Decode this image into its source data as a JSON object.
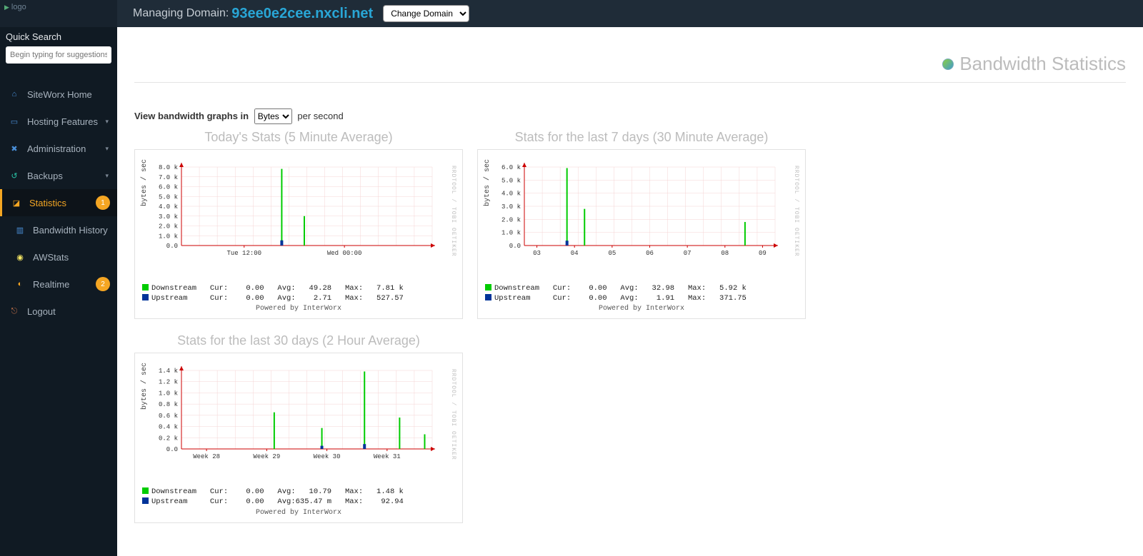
{
  "header": {
    "managing_label": "Managing Domain:",
    "domain": "93ee0e2cee.nxcli.net",
    "change_domain_label": "Change Domain"
  },
  "sidebar": {
    "logo_alt": "logo",
    "quick_search_title": "Quick Search",
    "quick_search_placeholder": "Begin typing for suggestions",
    "items": [
      {
        "label": "SiteWorx Home",
        "icon": "home",
        "expandable": false,
        "active": false
      },
      {
        "label": "Hosting Features",
        "icon": "host",
        "expandable": true,
        "active": false
      },
      {
        "label": "Administration",
        "icon": "admin",
        "expandable": true,
        "active": false
      },
      {
        "label": "Backups",
        "icon": "back",
        "expandable": true,
        "active": false
      },
      {
        "label": "Statistics",
        "icon": "stat",
        "expandable": true,
        "active": true,
        "badge": "1"
      },
      {
        "label": "Bandwidth History",
        "icon": "bw",
        "expandable": false,
        "active": false,
        "indent": true
      },
      {
        "label": "AWStats",
        "icon": "aw",
        "expandable": false,
        "active": false,
        "indent": true
      },
      {
        "label": "Realtime",
        "icon": "rt",
        "expandable": false,
        "active": false,
        "indent": true,
        "badge": "2"
      },
      {
        "label": "Logout",
        "icon": "lo",
        "expandable": false,
        "active": false
      }
    ]
  },
  "page": {
    "title": "Bandwidth Statistics",
    "graph_label_pre": "View bandwidth graphs in",
    "graph_unit_selected": "Bytes",
    "graph_label_post": "per second"
  },
  "chart_data": [
    {
      "title": "Today's Stats (5 Minute Average)",
      "type": "line",
      "ylabel": "bytes / sec",
      "yticks": [
        "0.0",
        "1.0 k",
        "2.0 k",
        "3.0 k",
        "4.0 k",
        "5.0 k",
        "6.0 k",
        "7.0 k",
        "8.0 k"
      ],
      "ymax": 8000,
      "xticks": [
        "Tue 12:00",
        "Wed 00:00"
      ],
      "series": [
        {
          "name": "Downstream",
          "color": "#00cc00"
        },
        {
          "name": "Upstream",
          "color": "#003399"
        }
      ],
      "spikes_down": [
        {
          "x": 0.4,
          "v": 7810
        },
        {
          "x": 0.49,
          "v": 3000
        }
      ],
      "spikes_up": [
        {
          "x": 0.4,
          "v": 528
        }
      ],
      "legend": {
        "down": {
          "cur": "0.00",
          "avg": "49.28",
          "max": "7.81 k"
        },
        "up": {
          "cur": "0.00",
          "avg": "2.71",
          "max": "527.57"
        }
      },
      "powered": "Powered by InterWorx"
    },
    {
      "title": "Stats for the last 7 days (30 Minute Average)",
      "type": "line",
      "ylabel": "bytes / sec",
      "yticks": [
        "0.0",
        "1.0 k",
        "2.0 k",
        "3.0 k",
        "4.0 k",
        "5.0 k",
        "6.0 k"
      ],
      "ymax": 6000,
      "xticks": [
        "03",
        "04",
        "05",
        "06",
        "07",
        "08",
        "09"
      ],
      "series": [
        {
          "name": "Downstream",
          "color": "#00cc00"
        },
        {
          "name": "Upstream",
          "color": "#003399"
        }
      ],
      "spikes_down": [
        {
          "x": 0.17,
          "v": 5920
        },
        {
          "x": 0.24,
          "v": 2800
        },
        {
          "x": 0.88,
          "v": 1800
        }
      ],
      "spikes_up": [
        {
          "x": 0.17,
          "v": 372
        }
      ],
      "legend": {
        "down": {
          "cur": "0.00",
          "avg": "32.98",
          "max": "5.92 k"
        },
        "up": {
          "cur": "0.00",
          "avg": "1.91",
          "max": "371.75"
        }
      },
      "powered": "Powered by InterWorx"
    },
    {
      "title": "Stats for the last 30 days (2 Hour Average)",
      "type": "line",
      "ylabel": "bytes / sec",
      "yticks": [
        "0.0",
        "0.2 k",
        "0.4 k",
        "0.6 k",
        "0.8 k",
        "1.0 k",
        "1.2 k",
        "1.4 k"
      ],
      "ymax": 1500,
      "xticks": [
        "Week 28",
        "Week 29",
        "Week 30",
        "Week 31"
      ],
      "series": [
        {
          "name": "Downstream",
          "color": "#00cc00"
        },
        {
          "name": "Upstream",
          "color": "#003399"
        }
      ],
      "spikes_down": [
        {
          "x": 0.37,
          "v": 700
        },
        {
          "x": 0.56,
          "v": 400
        },
        {
          "x": 0.73,
          "v": 1480
        },
        {
          "x": 0.87,
          "v": 600
        },
        {
          "x": 0.97,
          "v": 280
        }
      ],
      "spikes_up": [
        {
          "x": 0.73,
          "v": 93
        },
        {
          "x": 0.56,
          "v": 60
        }
      ],
      "legend": {
        "down": {
          "cur": "0.00",
          "avg": "10.79",
          "max": "1.48 k"
        },
        "up": {
          "cur": "0.00",
          "avg": "635.47 m",
          "max": "92.94"
        }
      },
      "powered": "Powered by InterWorx"
    }
  ]
}
